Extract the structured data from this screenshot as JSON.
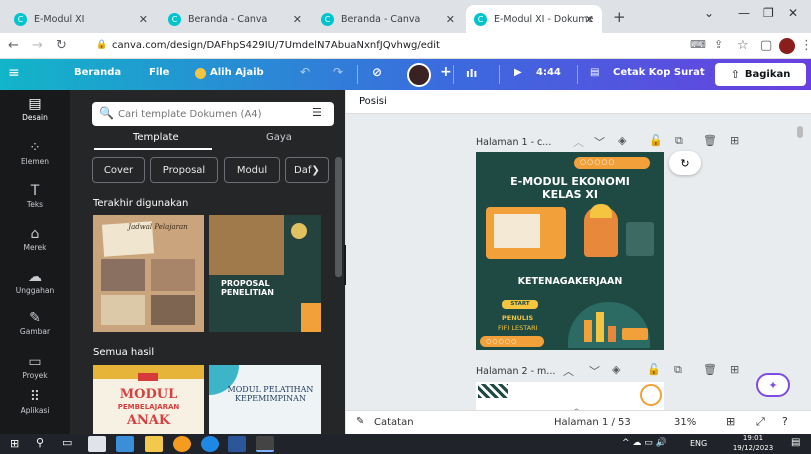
{
  "browser": {
    "tabs": [
      {
        "label": "E-Modul XI",
        "active": false
      },
      {
        "label": "Beranda - Canva",
        "active": false
      },
      {
        "label": "Beranda - Canva",
        "active": false
      },
      {
        "label": "E-Modul XI - Dokume",
        "active": true
      }
    ],
    "new_tab": "+",
    "url": "canva.com/design/DAFhpS429IU/7UmdelN7AbuaNxnfJQvhwg/edit"
  },
  "header": {
    "menu_icon": "menu-icon",
    "home": "Beranda",
    "file": "File",
    "magic": "Alih Ajaib",
    "timer": "4:44",
    "print": "Cetak Kop Surat",
    "share": "Bagikan"
  },
  "rail": [
    {
      "label": "Desain",
      "icon": "▤"
    },
    {
      "label": "Elemen",
      "icon": "⁘"
    },
    {
      "label": "Teks",
      "icon": "T"
    },
    {
      "label": "Merek",
      "icon": "⌂"
    },
    {
      "label": "Unggahan",
      "icon": "☁"
    },
    {
      "label": "Gambar",
      "icon": "✎"
    },
    {
      "label": "Proyek",
      "icon": "▭"
    },
    {
      "label": "Aplikasi",
      "icon": "⠿"
    }
  ],
  "panel": {
    "search_placeholder": "Cari template Dokumen (A4)",
    "tab_template": "Template",
    "tab_style": "Gaya",
    "chips": [
      "Cover",
      "Proposal",
      "Modul",
      "Daf"
    ],
    "recent_heading": "Terakhir digunakan",
    "results_heading": "Semua hasil",
    "thumb_journal_title": "Jadwal Pelajaran",
    "thumb_proposal": "PROPOSAL PENELITIAN",
    "thumb_modul_1": "MODUL",
    "thumb_modul_1b": "PEMBELAJARAN",
    "thumb_modul_1c": "ANAK",
    "thumb_modul_2": "MODUL PELATIHAN KEPEMIMPINAN"
  },
  "canvas": {
    "posisi": "Posisi",
    "page1_label": "Halaman 1 - c...",
    "page2_label": "Halaman 2 - m...",
    "cover_title_1": "E-MODUL EKONOMI",
    "cover_title_2": "KELAS XI",
    "cover_subject": "KETENAGAKERJAAN",
    "cover_start": "START",
    "cover_author_label": "PENULIS",
    "cover_author": "FIFI LESTARI"
  },
  "footer": {
    "notes": "Catatan",
    "page_count": "Halaman 1 / 53",
    "zoom": "31%"
  },
  "taskbar": {
    "lang": "ENG",
    "time": "19:01",
    "date": "19/12/2023"
  },
  "colors": {
    "canva_teal": "#12b5c9",
    "canva_purple": "#6a3fe0",
    "cover_green": "#1f4a43",
    "cover_orange": "#f2a03a"
  }
}
